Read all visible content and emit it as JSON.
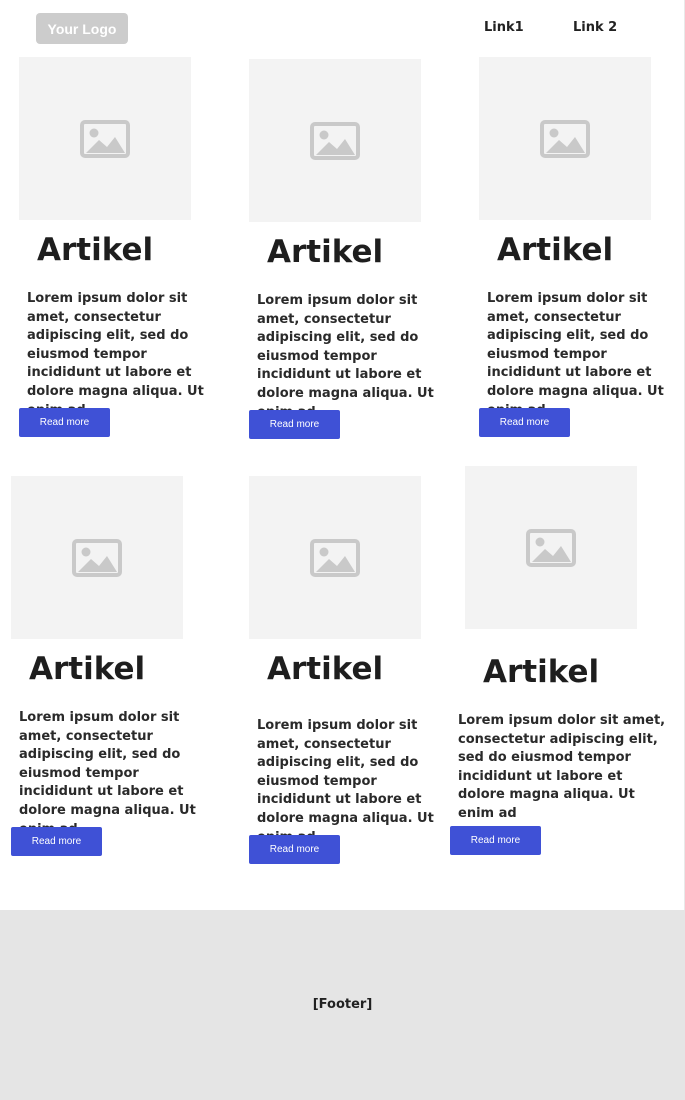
{
  "header": {
    "logo": "Your Logo",
    "nav": [
      "Link1",
      "Link 2"
    ]
  },
  "articles": [
    {
      "title": "Artikel",
      "text": "Lorem ipsum dolor sit amet, consectetur adipiscing elit, sed do eiusmod tempor incididunt ut labore et dolore magna aliqua. Ut enim ad",
      "button": "Read more",
      "image_icon": "image-placeholder-icon"
    },
    {
      "title": "Artikel",
      "text": "Lorem ipsum dolor sit amet, consectetur adipiscing elit, sed do eiusmod tempor incididunt ut labore et dolore magna aliqua. Ut enim ad",
      "button": "Read more",
      "image_icon": "image-placeholder-icon"
    },
    {
      "title": "Artikel",
      "text": "Lorem ipsum dolor sit amet, consectetur adipiscing elit, sed do eiusmod tempor incididunt ut labore et dolore magna aliqua. Ut enim ad",
      "button": "Read more",
      "image_icon": "image-placeholder-icon"
    },
    {
      "title": "Artikel",
      "text": "Lorem ipsum dolor sit amet, consectetur adipiscing elit, sed do eiusmod tempor incididunt ut labore et dolore magna aliqua. Ut enim ad",
      "button": "Read more",
      "image_icon": "image-placeholder-icon"
    },
    {
      "title": "Artikel",
      "text": "Lorem ipsum dolor sit amet, consectetur adipiscing elit, sed do eiusmod tempor incididunt ut labore et dolore magna aliqua. Ut enim ad",
      "button": "Read more",
      "image_icon": "image-placeholder-icon"
    },
    {
      "title": "Artikel",
      "text": "Lorem ipsum dolor sit amet, consectetur adipiscing elit, sed do eiusmod tempor incididunt ut labore et dolore magna aliqua. Ut enim ad",
      "button": "Read more",
      "image_icon": "image-placeholder-icon"
    }
  ],
  "footer": {
    "label": "[Footer]"
  },
  "colors": {
    "button": "#3f51d6",
    "placeholder": "#f3f3f3",
    "footer_bg": "#e5e5e5",
    "logo_bg": "#cccccc"
  }
}
